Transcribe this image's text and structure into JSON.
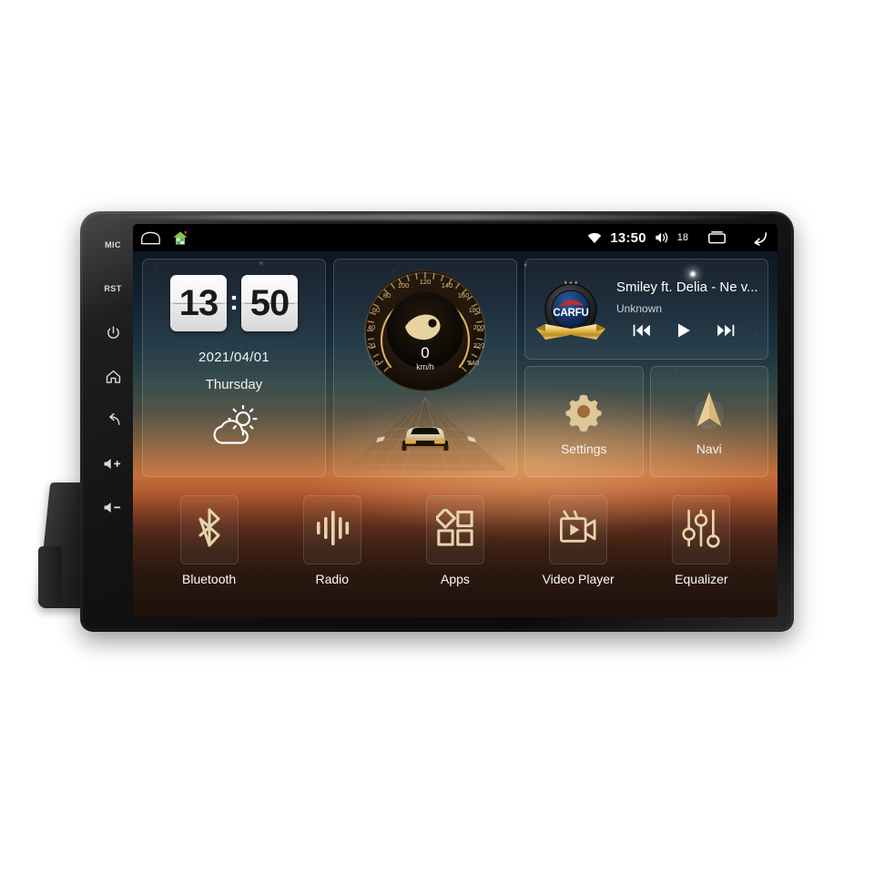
{
  "device": {
    "hard_keys": [
      {
        "name": "mic",
        "label": "MIC",
        "type": "text"
      },
      {
        "name": "reset",
        "label": "RST",
        "type": "text"
      },
      {
        "name": "power",
        "label": "",
        "type": "icon"
      },
      {
        "name": "home",
        "label": "",
        "type": "icon"
      },
      {
        "name": "back",
        "label": "",
        "type": "icon"
      },
      {
        "name": "volume-up",
        "label": "",
        "type": "icon"
      },
      {
        "name": "volume-down",
        "label": "",
        "type": "icon"
      }
    ]
  },
  "statusbar": {
    "left_icons": [
      "home-outline-icon",
      "house-app-icon"
    ],
    "wifi_icon": "wifi-icon",
    "time": "13:50",
    "volume_icon": "volume-icon",
    "volume_level": "18",
    "recents_icon": "recents-icon",
    "back_icon": "back-icon"
  },
  "clock_widget": {
    "hours": "13",
    "separator": ":",
    "minutes": "50",
    "date": "2021/04/01",
    "weekday": "Thursday",
    "weather_icon": "partly-cloudy-icon"
  },
  "speedometer_widget": {
    "value": "0",
    "unit": "km/h",
    "ticks": [
      "0",
      "20",
      "40",
      "60",
      "80",
      "100",
      "120",
      "140",
      "160",
      "180",
      "200",
      "220",
      "240"
    ],
    "min": 0,
    "max": 240
  },
  "music_widget": {
    "album_art": "carfu-badge-icon",
    "album_art_text": "CARFU",
    "title": "Smiley ft. Delia - Ne v...",
    "artist": "Unknown",
    "controls": [
      {
        "name": "previous-track-button",
        "icon": "skip-previous-icon"
      },
      {
        "name": "play-button",
        "icon": "play-icon"
      },
      {
        "name": "next-track-button",
        "icon": "skip-next-icon"
      }
    ]
  },
  "tiles": [
    {
      "name": "settings",
      "label": "Settings",
      "icon": "gear-icon"
    },
    {
      "name": "navi",
      "label": "Navi",
      "icon": "navigation-arrow-icon"
    }
  ],
  "dock": [
    {
      "name": "bluetooth",
      "label": "Bluetooth",
      "icon": "bluetooth-icon"
    },
    {
      "name": "radio",
      "label": "Radio",
      "icon": "radio-waveform-icon"
    },
    {
      "name": "apps",
      "label": "Apps",
      "icon": "apps-grid-icon"
    },
    {
      "name": "video-player",
      "label": "Video Player",
      "icon": "video-camera-icon"
    },
    {
      "name": "equalizer",
      "label": "Equalizer",
      "icon": "equalizer-sliders-icon"
    }
  ],
  "colors": {
    "gold": "#e2cfa4",
    "sky": "#12222f",
    "horizon": "#c4703a",
    "ground": "#2a1810",
    "text": "#ffffff"
  }
}
